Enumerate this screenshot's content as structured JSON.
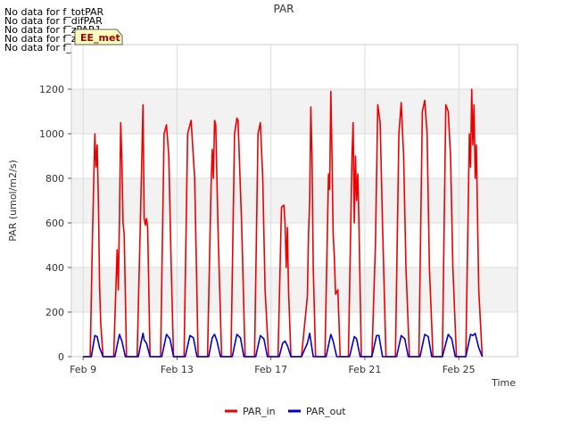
{
  "no_data_messages": [
    "No data for f_totPAR",
    "No data for f_difPAR",
    "No data for f_zPAR1",
    "No data for f_zPAR2",
    "No data for f_zPAR3"
  ],
  "badge_label": "EE_met",
  "chart_data": {
    "type": "line",
    "title": "PAR",
    "xlabel": "Time",
    "ylabel": "PAR (umol/m2/s)",
    "xlim": [
      8.5,
      27.5
    ],
    "ylim": [
      0,
      1400
    ],
    "yticks": [
      0,
      200,
      400,
      600,
      800,
      1000,
      1200
    ],
    "xticks": [
      {
        "value": 9,
        "label": "Feb 9"
      },
      {
        "value": 13,
        "label": "Feb 13"
      },
      {
        "value": 17,
        "label": "Feb 17"
      },
      {
        "value": 21,
        "label": "Feb 21"
      },
      {
        "value": 25,
        "label": "Feb 25"
      }
    ],
    "grid": true,
    "shaded_bands": [
      [
        200,
        400
      ],
      [
        600,
        800
      ],
      [
        1000,
        1200
      ]
    ],
    "legend_position": "bottom",
    "series": [
      {
        "name": "PAR_in",
        "color": "#ee0000",
        "x": [
          9.0,
          9.3,
          9.4,
          9.5,
          9.55,
          9.6,
          9.65,
          9.7,
          9.75,
          9.85,
          9.95,
          10.0,
          10.3,
          10.45,
          10.5,
          10.55,
          10.6,
          10.65,
          10.7,
          10.75,
          10.85,
          11.0,
          11.3,
          11.45,
          11.5,
          11.55,
          11.6,
          11.65,
          11.7,
          11.75,
          11.85,
          12.3,
          12.45,
          12.55,
          12.65,
          12.75,
          12.85,
          12.95,
          13.3,
          13.45,
          13.6,
          13.75,
          13.9,
          14.3,
          14.45,
          14.5,
          14.55,
          14.6,
          14.65,
          14.75,
          14.9,
          15.3,
          15.45,
          15.55,
          15.6,
          15.75,
          15.9,
          16.3,
          16.45,
          16.55,
          16.65,
          16.75,
          16.9,
          17.3,
          17.45,
          17.55,
          17.6,
          17.65,
          17.7,
          17.75,
          17.85,
          17.95,
          18.3,
          18.55,
          18.6,
          18.65,
          18.7,
          18.75,
          18.8,
          18.9,
          19.3,
          19.45,
          19.5,
          19.55,
          19.6,
          19.65,
          19.7,
          19.75,
          19.85,
          19.95,
          20.3,
          20.45,
          20.5,
          20.55,
          20.6,
          20.65,
          20.7,
          20.75,
          20.85,
          21.3,
          21.45,
          21.55,
          21.65,
          21.75,
          21.9,
          22.3,
          22.45,
          22.55,
          22.65,
          22.75,
          22.9,
          23.3,
          23.45,
          23.55,
          23.65,
          23.75,
          23.9,
          24.3,
          24.45,
          24.55,
          24.65,
          24.75,
          24.9,
          25.3,
          25.45,
          25.5,
          25.55,
          25.6,
          25.65,
          25.7,
          25.75,
          25.85,
          26.0
        ],
        "y": [
          0,
          0,
          550,
          1000,
          850,
          950,
          700,
          320,
          150,
          0,
          0,
          0,
          0,
          480,
          300,
          620,
          1050,
          880,
          600,
          550,
          0,
          0,
          0,
          650,
          880,
          1130,
          620,
          590,
          620,
          580,
          0,
          0,
          1000,
          1040,
          900,
          420,
          0,
          0,
          0,
          1000,
          1060,
          800,
          0,
          0,
          770,
          930,
          800,
          1060,
          1040,
          550,
          0,
          0,
          1000,
          1070,
          1060,
          600,
          0,
          0,
          1000,
          1050,
          800,
          300,
          0,
          0,
          670,
          680,
          600,
          400,
          580,
          300,
          0,
          0,
          0,
          270,
          550,
          700,
          1120,
          900,
          400,
          0,
          0,
          820,
          750,
          1190,
          900,
          550,
          450,
          280,
          300,
          0,
          0,
          900,
          1050,
          600,
          900,
          700,
          820,
          580,
          0,
          0,
          500,
          1130,
          1050,
          600,
          0,
          0,
          1000,
          1140,
          900,
          400,
          0,
          0,
          1100,
          1150,
          1000,
          400,
          0,
          0,
          1130,
          1100,
          900,
          400,
          0,
          0,
          1000,
          850,
          1200,
          950,
          1130,
          800,
          950,
          300,
          0
        ]
      },
      {
        "name": "PAR_out",
        "color": "#0000cc",
        "x": [
          9.0,
          9.35,
          9.5,
          9.6,
          9.7,
          9.85,
          10.35,
          10.55,
          10.65,
          10.8,
          11.35,
          11.5,
          11.55,
          11.6,
          11.7,
          11.85,
          12.35,
          12.55,
          12.7,
          12.85,
          13.35,
          13.55,
          13.7,
          13.85,
          14.35,
          14.5,
          14.6,
          14.7,
          14.85,
          15.35,
          15.55,
          15.7,
          15.85,
          16.35,
          16.55,
          16.7,
          16.85,
          17.35,
          17.5,
          17.6,
          17.7,
          17.85,
          18.3,
          18.55,
          18.65,
          18.8,
          19.35,
          19.55,
          19.65,
          19.8,
          20.35,
          20.55,
          20.65,
          20.8,
          21.3,
          21.5,
          21.6,
          21.75,
          22.35,
          22.55,
          22.7,
          22.85,
          23.35,
          23.55,
          23.7,
          23.85,
          24.3,
          24.55,
          24.7,
          24.85,
          25.3,
          25.5,
          25.6,
          25.7,
          25.85,
          26.0
        ],
        "y": [
          0,
          0,
          95,
          90,
          40,
          0,
          0,
          100,
          70,
          0,
          0,
          80,
          105,
          75,
          60,
          0,
          0,
          100,
          80,
          0,
          0,
          95,
          85,
          0,
          0,
          85,
          100,
          70,
          0,
          0,
          100,
          85,
          0,
          0,
          95,
          80,
          0,
          0,
          60,
          70,
          50,
          0,
          0,
          60,
          105,
          0,
          0,
          100,
          70,
          0,
          0,
          90,
          80,
          0,
          0,
          95,
          95,
          0,
          0,
          95,
          80,
          0,
          0,
          100,
          90,
          0,
          0,
          100,
          80,
          0,
          0,
          100,
          95,
          105,
          40,
          0
        ]
      }
    ]
  }
}
